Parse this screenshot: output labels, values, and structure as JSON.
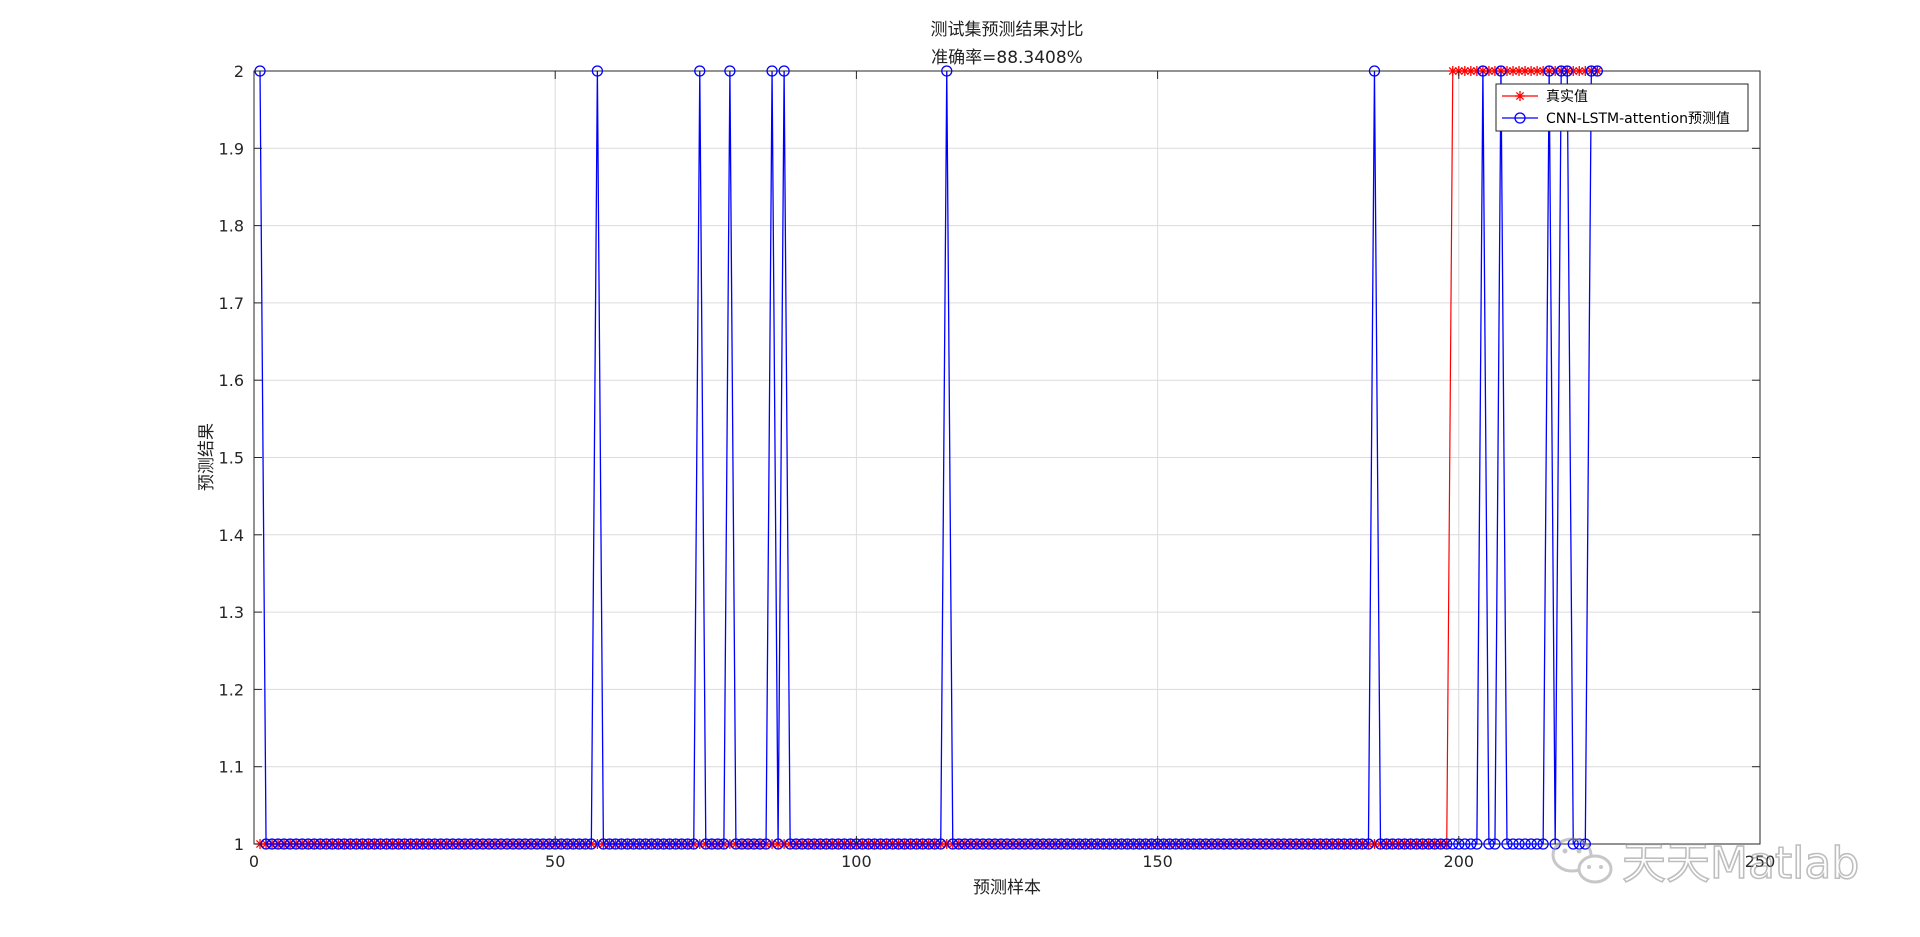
{
  "chart_data": {
    "type": "line",
    "title": "测试集预测结果对比",
    "subtitle": "准确率=88.3408%",
    "xlabel": "预测样本",
    "ylabel": "预测结果",
    "xlim": [
      0,
      250
    ],
    "ylim": [
      1,
      2
    ],
    "xticks": [
      "0",
      "50",
      "100",
      "150",
      "200",
      "250"
    ],
    "yticks": [
      "1",
      "1.1",
      "1.2",
      "1.3",
      "1.4",
      "1.5",
      "1.6",
      "1.7",
      "1.8",
      "1.9",
      "2"
    ],
    "grid": true,
    "legend_position": "top-right",
    "n_samples": 223,
    "series": [
      {
        "name": "真实值",
        "color": "#ff0000",
        "marker": "asterisk",
        "segments": [
          {
            "from": 1,
            "to": 198,
            "value": 1
          },
          {
            "from": 199,
            "to": 223,
            "value": 2
          }
        ]
      },
      {
        "name": "CNN-LSTM-attention预测值",
        "color": "#0000ff",
        "marker": "circle",
        "default_value": 1,
        "values_equal_2_at": [
          1,
          57,
          74,
          79,
          86,
          88,
          115,
          186,
          204,
          207,
          215,
          217,
          218,
          222,
          223
        ]
      }
    ]
  },
  "watermark": {
    "text": "天天Matlab",
    "icon": "wechat-icon"
  }
}
